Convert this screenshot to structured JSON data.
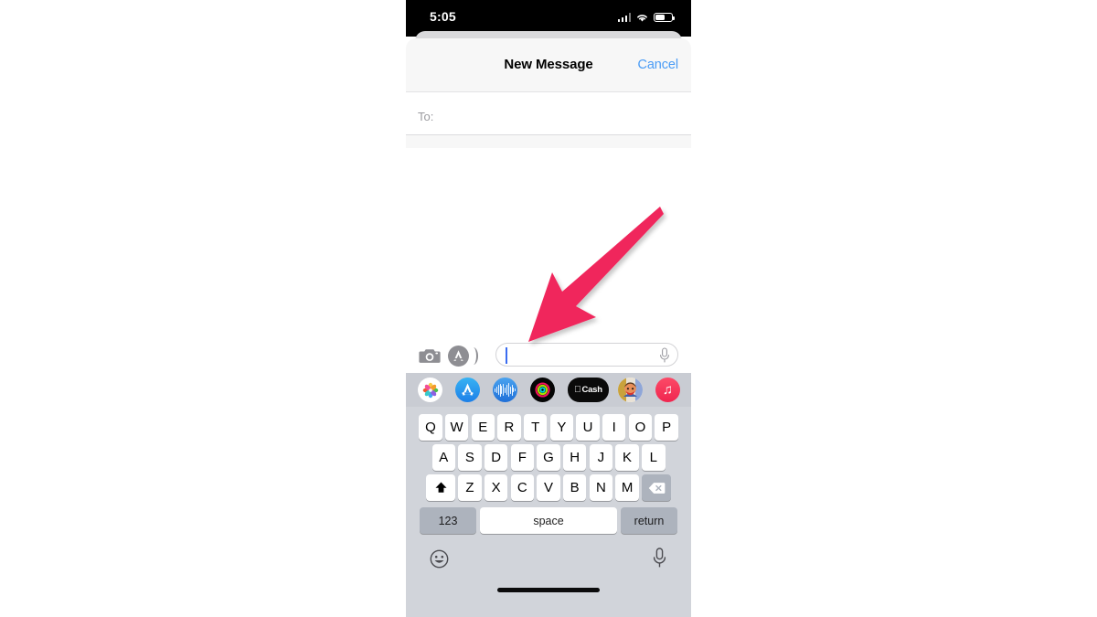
{
  "device": {
    "status_bar": {
      "time": "5:05",
      "signal_icon": "cellular-signal-icon",
      "wifi_icon": "wifi-icon",
      "battery_icon": "battery-icon"
    }
  },
  "sheet": {
    "nav": {
      "title": "New Message",
      "cancel_label": "Cancel",
      "cancel_color": "#4a9cf6"
    },
    "recipient_field": {
      "label": "To:",
      "value": "",
      "placeholder": ""
    }
  },
  "compose_bar": {
    "camera_icon": "camera-icon",
    "appstore_icon": "app-store-icon",
    "message_input": {
      "value": "",
      "placeholder": "",
      "caret_color": "#3b6cf0"
    },
    "dictation_icon": "microphone-icon"
  },
  "app_drawer": {
    "background": "#c9ccd3",
    "apps": [
      {
        "name": "photos-app-icon",
        "label": "Photos"
      },
      {
        "name": "app-store-app-icon",
        "label": "App Store"
      },
      {
        "name": "digital-touch-app-icon",
        "label": "Digital Touch"
      },
      {
        "name": "fitness-activity-app-icon",
        "label": "Activity"
      },
      {
        "name": "apple-cash-app-icon",
        "label": "Cash"
      },
      {
        "name": "memoji-app-icon",
        "label": "Memoji"
      },
      {
        "name": "apple-music-app-icon",
        "label": "Music"
      }
    ]
  },
  "keyboard": {
    "row1": [
      "Q",
      "W",
      "E",
      "R",
      "T",
      "Y",
      "U",
      "I",
      "O",
      "P"
    ],
    "row2": [
      "A",
      "S",
      "D",
      "F",
      "G",
      "H",
      "J",
      "K",
      "L"
    ],
    "row3": [
      "Z",
      "X",
      "C",
      "V",
      "B",
      "N",
      "M"
    ],
    "shift_icon": "shift-key-icon",
    "delete_icon": "delete-backspace-icon",
    "numeric_label": "123",
    "space_label": "space",
    "return_label": "return",
    "emoji_icon": "emoji-smiley-icon",
    "dictation_icon": "microphone-icon",
    "key_color": "#ffffff",
    "function_key_color": "#adb3bd",
    "background": "#d1d4da"
  },
  "annotation": {
    "arrow": {
      "name": "pink-pointer-arrow",
      "color": "#f0275c",
      "points_to": "message-input-field"
    }
  }
}
